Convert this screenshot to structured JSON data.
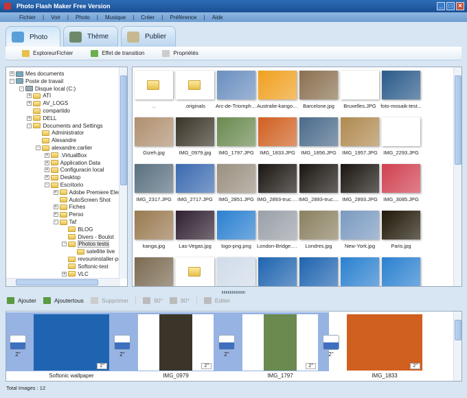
{
  "window": {
    "title": "Photo Flash Maker Free Version",
    "controls": [
      "_",
      "□",
      "✕"
    ]
  },
  "menu": [
    "Fichier",
    "Voir",
    "Photo",
    "Musique",
    "Créer",
    "Préférence",
    "Aide"
  ],
  "tabs": [
    {
      "label": "Photo",
      "color": "#5aa0d8",
      "active": true
    },
    {
      "label": "Thème",
      "color": "#6c8a6a"
    },
    {
      "label": "Publier",
      "color": "#c8b890"
    }
  ],
  "subtoolbar": [
    {
      "label": "ExploreurFichier",
      "color": "#e8c04a"
    },
    {
      "label": "Effet de transition",
      "color": "#6ab04c"
    },
    {
      "label": "Propriétés",
      "color": "#ccc"
    }
  ],
  "tree": [
    {
      "label": "Mes documents",
      "level": 0,
      "toggle": "+"
    },
    {
      "label": "Poste de travail",
      "level": 0,
      "toggle": "-"
    },
    {
      "label": "Disque local (C:)",
      "level": 1,
      "toggle": "-"
    },
    {
      "label": "ATI",
      "level": 2,
      "toggle": "+"
    },
    {
      "label": "AV_LOGS",
      "level": 2,
      "toggle": "+"
    },
    {
      "label": "compartido",
      "level": 2
    },
    {
      "label": "DELL",
      "level": 2,
      "toggle": "+"
    },
    {
      "label": "Documents and Settings",
      "level": 2,
      "toggle": "-"
    },
    {
      "label": "Administrator",
      "level": 3
    },
    {
      "label": "Alexandre",
      "level": 3
    },
    {
      "label": "alexandre.carlier",
      "level": 3,
      "toggle": "-"
    },
    {
      "label": ".VirtualBox",
      "level": 4,
      "toggle": "+"
    },
    {
      "label": "Application Data",
      "level": 4,
      "toggle": "+"
    },
    {
      "label": "Configuracin local",
      "level": 4,
      "toggle": "+"
    },
    {
      "label": "Desktop",
      "level": 4,
      "toggle": "+"
    },
    {
      "label": "Escritorio",
      "level": 4,
      "toggle": "-"
    },
    {
      "label": "Adobe Premiere Elem",
      "level": 5,
      "toggle": "+"
    },
    {
      "label": "AutoScreen Shot",
      "level": 5
    },
    {
      "label": "Fiches",
      "level": 5,
      "toggle": "+"
    },
    {
      "label": "Perso",
      "level": 5,
      "toggle": "+"
    },
    {
      "label": "Taf",
      "level": 5,
      "toggle": "-"
    },
    {
      "label": "BLOG",
      "level": 6
    },
    {
      "label": "Divers - Boulot",
      "level": 6
    },
    {
      "label": "Photos tests",
      "level": 6,
      "toggle": "-",
      "selected": true
    },
    {
      "label": "satellite live",
      "level": 7
    },
    {
      "label": "revouninstaller-pc",
      "level": 6
    },
    {
      "label": "Softonic-test",
      "level": 6
    },
    {
      "label": "VLC",
      "level": 6,
      "toggle": "+"
    }
  ],
  "files": [
    {
      "name": "..",
      "type": "folder"
    },
    {
      "name": ".originals",
      "type": "folder"
    },
    {
      "name": "Arc-de-Triomphe...",
      "color": "#6a8fc0"
    },
    {
      "name": "Australie-kangou...",
      "color": "#f0a020"
    },
    {
      "name": "Barcelone.jpg",
      "color": "#8a7050"
    },
    {
      "name": "Bruxelles.JPG",
      "color": "#888"
    },
    {
      "name": "foto-mosaik-test...",
      "color": "#2a5a8a"
    },
    {
      "name": "Gizeh.jpg",
      "color": "#b09070"
    },
    {
      "name": "IMG_0979.jpg",
      "color": "#3a3528"
    },
    {
      "name": "IMG_1797.JPG",
      "color": "#6a8a50"
    },
    {
      "name": "IMG_1833.JPG",
      "color": "#d06020"
    },
    {
      "name": "IMG_1856.JPG",
      "color": "#4a6a8a"
    },
    {
      "name": "IMG_1957.JPG",
      "color": "#b08a50"
    },
    {
      "name": "IMG_2293.JPG",
      "color": "#333"
    },
    {
      "name": "IMG_2317.JPG",
      "color": "#5a7080"
    },
    {
      "name": "IMG_2717.JPG",
      "color": "#3a6ab0"
    },
    {
      "name": "IMG_2851.JPG",
      "color": "#9a9080"
    },
    {
      "name": "IMG_2893-truc.J...",
      "color": "#1a1510"
    },
    {
      "name": "IMG_2893-truc....",
      "color": "#1a1510"
    },
    {
      "name": "IMG_2893.JPG",
      "color": "#1a1510"
    },
    {
      "name": "IMG_3085.JPG",
      "color": "#d04050"
    },
    {
      "name": "kanga.jpg",
      "color": "#9a7a50"
    },
    {
      "name": "Las-Vegas.jpg",
      "color": "#302030"
    },
    {
      "name": "logo-png.png",
      "color": "#2a80d0"
    },
    {
      "name": "London-Bridge.jpg",
      "color": "#9aa0a8"
    },
    {
      "name": "Londres.jpg",
      "color": "#8a8060"
    },
    {
      "name": "New-York.jpg",
      "color": "#7a9ac0"
    },
    {
      "name": "Paris.jpg",
      "color": "#201808"
    },
    {
      "name": "",
      "color": "#7a6a50"
    },
    {
      "name": "",
      "type": "folder"
    },
    {
      "name": "",
      "color": "#d0dcea"
    },
    {
      "name": "",
      "color": "#1e64b0"
    },
    {
      "name": "",
      "color": "#1e64b0"
    },
    {
      "name": "",
      "color": "#2a80d0"
    },
    {
      "name": "",
      "color": "#2a80d0"
    }
  ],
  "bottom_toolbar": {
    "add": "Ajouter",
    "add_all": "Ajoutertous",
    "delete": "Supprimer",
    "rotate_left": "90°",
    "rotate_right": "90°",
    "edit": "Editer"
  },
  "storyboard": [
    {
      "label": "Softonic wallpaper",
      "duration": "2''",
      "transition": "2''",
      "color": "#1e64b0"
    },
    {
      "label": "IMG_0979",
      "duration": "2''",
      "transition": "2''",
      "color": "#3a3528"
    },
    {
      "label": "IMG_1797",
      "duration": "2''",
      "transition": "2''",
      "color": "#6a8a50"
    },
    {
      "label": "IMG_1833",
      "duration": "2''",
      "transition": "2''",
      "color": "#d06020"
    }
  ],
  "status": "Total Images : 12"
}
